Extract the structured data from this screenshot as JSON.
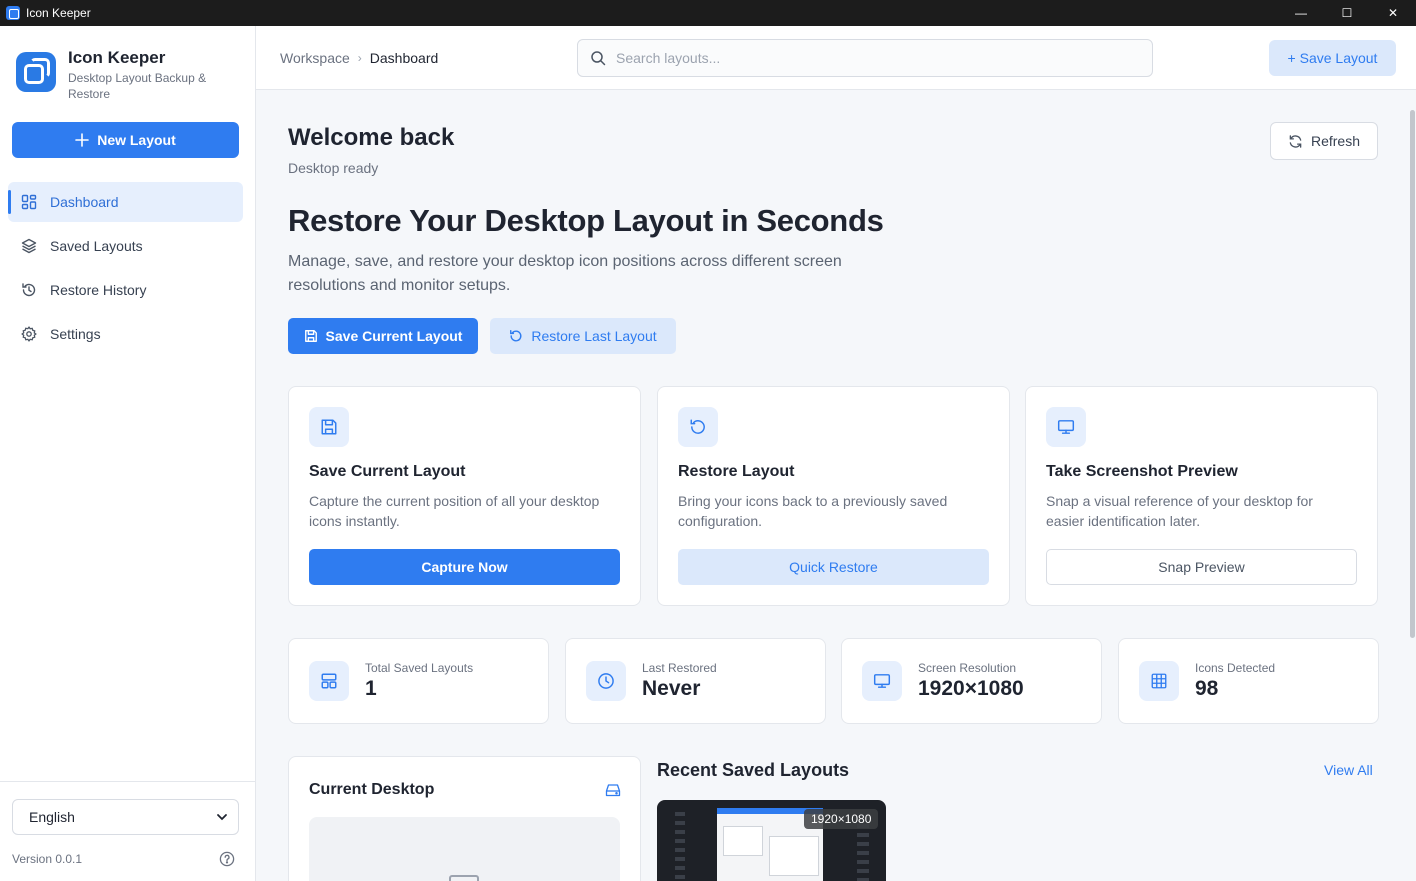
{
  "window": {
    "title": "Icon Keeper",
    "minimize": "—",
    "maximize": "☐",
    "close": "✕"
  },
  "sidebar": {
    "brand_name": "Icon Keeper",
    "brand_subtitle": "Desktop Layout Backup & Restore",
    "new_layout_label": "New Layout",
    "items": [
      {
        "label": "Dashboard",
        "icon": "grid-icon",
        "active": true
      },
      {
        "label": "Saved Layouts",
        "icon": "layers-icon",
        "active": false
      },
      {
        "label": "Restore History",
        "icon": "history-icon",
        "active": false
      },
      {
        "label": "Settings",
        "icon": "gear-icon",
        "active": false
      }
    ],
    "language": "English",
    "version": "Version 0.0.1"
  },
  "header": {
    "breadcrumb": [
      "Workspace",
      "Dashboard"
    ],
    "breadcrumb_separator": "›",
    "search_placeholder": "Search layouts...",
    "search_value": "",
    "save_layout_label": "+ Save Layout"
  },
  "main": {
    "welcome": "Welcome back",
    "status": "Desktop ready",
    "refresh_label": "Refresh",
    "hero_title": "Restore Your Desktop Layout in Seconds",
    "hero_description": "Manage, save, and restore your desktop icon positions across different screen resolutions and monitor setups.",
    "primary_action": "Save Current Layout",
    "secondary_action": "Restore Last Layout",
    "cards": [
      {
        "title": "Save Current Layout",
        "description": "Capture the current position of all your desktop icons instantly.",
        "button": "Capture Now",
        "icon": "save-icon"
      },
      {
        "title": "Restore Layout",
        "description": "Bring your icons back to a previously saved configuration.",
        "button": "Quick Restore",
        "icon": "restore-icon"
      },
      {
        "title": "Take Screenshot Preview",
        "description": "Snap a visual reference of your desktop for easier identification later.",
        "button": "Snap Preview",
        "icon": "monitor-icon"
      }
    ],
    "stats": [
      {
        "label": "Total Saved Layouts",
        "value": "1",
        "icon": "layout-icon"
      },
      {
        "label": "Last Restored",
        "value": "Never",
        "icon": "clock-icon"
      },
      {
        "label": "Screen Resolution",
        "value": "1920×1080",
        "icon": "monitor-icon"
      },
      {
        "label": "Icons Detected",
        "value": "98",
        "icon": "grid-table-icon"
      }
    ],
    "current_desktop_title": "Current Desktop",
    "recent_title": "Recent Saved Layouts",
    "view_all": "View All",
    "recent_items": [
      {
        "resolution": "1920×1080"
      }
    ]
  },
  "colors": {
    "accent": "#2f7cf0",
    "accent_soft": "#dbe8fb",
    "sidebar_active_bg": "#e6effd",
    "titlebar": "#1c1c1c"
  }
}
